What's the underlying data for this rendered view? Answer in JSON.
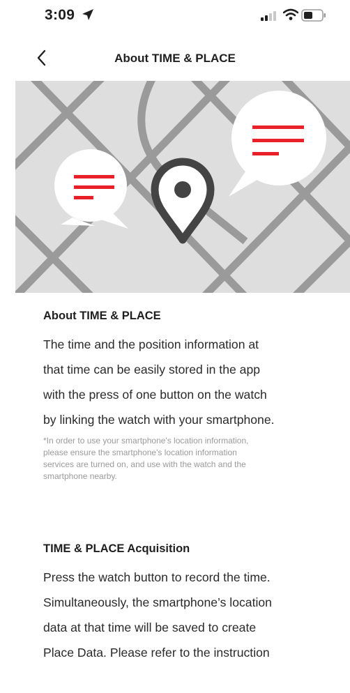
{
  "status_bar": {
    "time": "3:09",
    "icons": [
      "location-arrow-icon",
      "cellular-signal-icon",
      "wifi-icon",
      "battery-icon"
    ]
  },
  "nav": {
    "title": "About TIME & PLACE",
    "back_icon": "chevron-left-icon"
  },
  "hero": {
    "description_icons": [
      "map-background",
      "speech-bubble-icon",
      "location-pin-icon",
      "speech-bubble-icon"
    ],
    "colors": {
      "map_bg": "#dedede",
      "road": "#9a9a9a",
      "accent": "#e8202a",
      "pin": "#444444"
    }
  },
  "section1": {
    "heading": "About TIME & PLACE",
    "lines": [
      "The time and the position information at",
      "that time can be easily stored in the app",
      "with the press of one button on the watch",
      "by linking the watch with your smartphone."
    ],
    "footnote_lines": [
      "*In order to use your smartphone's location information,",
      "please ensure the smartphone's location information",
      "services are turned on, and use with the watch and the",
      "smartphone nearby."
    ]
  },
  "section2": {
    "heading": "TIME & PLACE Acquisition",
    "lines": [
      "Press the watch button to record the time.",
      "Simultaneously, the smartphone’s location",
      "data at that time will be saved to create",
      "Place Data. Please refer to the instruction"
    ]
  }
}
